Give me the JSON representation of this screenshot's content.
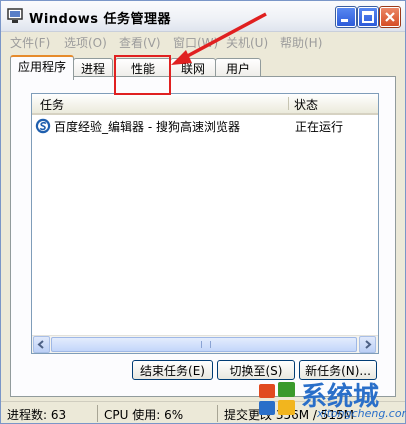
{
  "window": {
    "title": "Windows 任务管理器"
  },
  "menu": [
    "文件(F)",
    "选项(O)",
    "查看(V)",
    "窗口(W)",
    "关机(U)",
    "帮助(H)"
  ],
  "tabs": [
    {
      "label": "应用程序",
      "active": true
    },
    {
      "label": "进程",
      "active": false
    },
    {
      "label": "性能",
      "active": false
    },
    {
      "label": "联网",
      "active": false
    },
    {
      "label": "用户",
      "active": false
    }
  ],
  "list": {
    "columns": {
      "task": "任务",
      "status": "状态"
    },
    "rows": [
      {
        "name": "百度经验_编辑器 - 搜狗高速浏览器",
        "status": "正在运行",
        "icon": "sogou-browser-icon"
      }
    ]
  },
  "buttons": {
    "end_task": "结束任务(E)",
    "switch_to": "切换至(S)",
    "new_task": "新任务(N)..."
  },
  "statusbar": {
    "processes": "进程数: 63",
    "cpu": "CPU 使用: 6%",
    "commit": "提交更改 356M / 515M"
  },
  "watermark": {
    "text": "系统城",
    "sub": "xitongcheng.com"
  },
  "colors": {
    "highlight": "#e02020",
    "active_tab_accent": "#e68b2c",
    "watermark": "#2a6fc9"
  }
}
